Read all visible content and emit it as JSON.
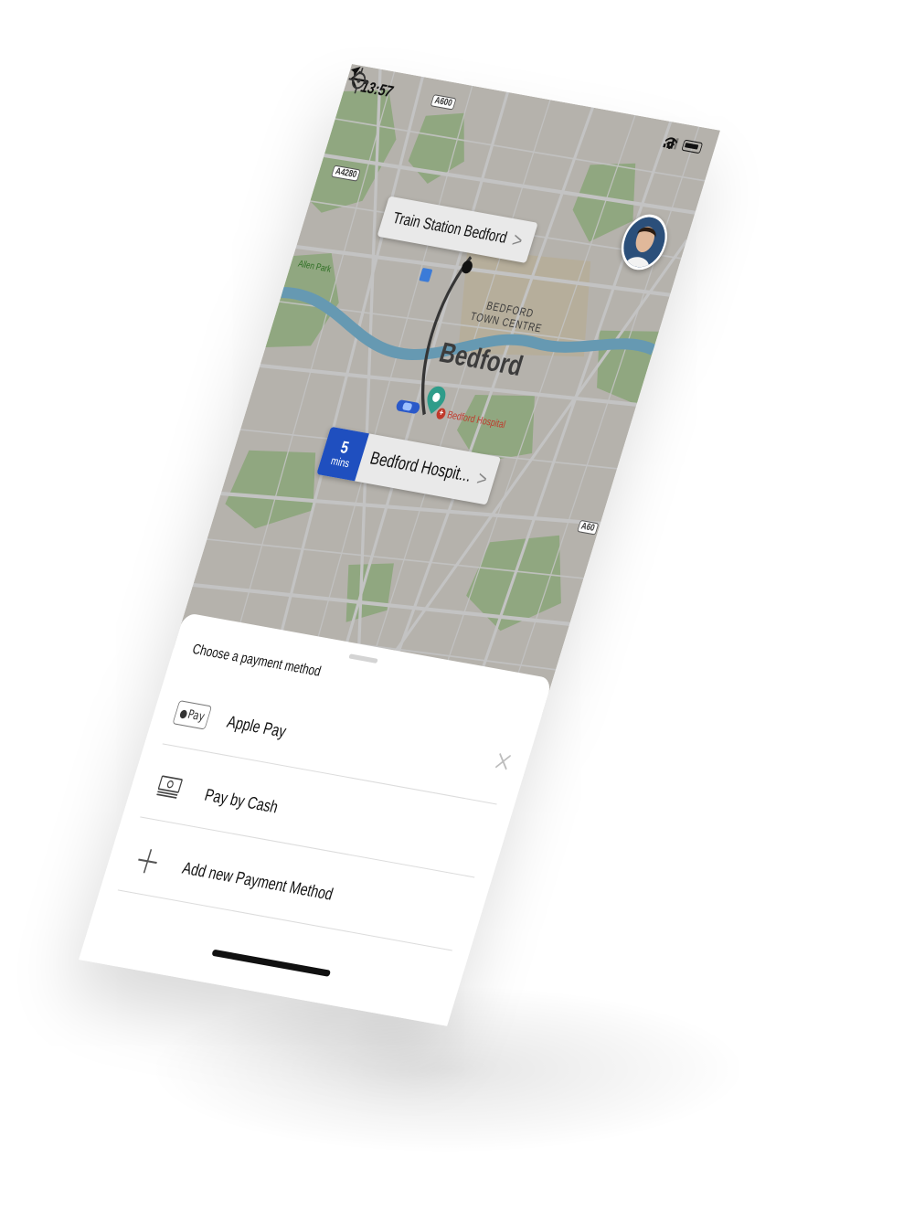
{
  "status_bar": {
    "time": "13:57"
  },
  "map": {
    "road_labels": [
      "A600",
      "A4280",
      "A60"
    ],
    "place_labels": {
      "park": "Allen Park",
      "town_centre_line1": "BEDFORD",
      "town_centre_line2": "TOWN CENTRE",
      "city": "Bedford",
      "hospital": "Bedford Hospital"
    },
    "pickup_callout": {
      "label": "Train Station Bedford",
      "chevron": ">"
    },
    "destination_callout": {
      "eta_value": "5",
      "eta_unit": "mins",
      "label": "Bedford Hospit...",
      "chevron": ">"
    },
    "colors": {
      "land": "#e8e4dc",
      "park": "#b9d9a2",
      "river": "#7ec5e8",
      "route": "#3b3b3b",
      "pickup_pin": "#e07a2c",
      "destination_pin": "#2f9c8a",
      "eta_badge": "#1f4fbf"
    }
  },
  "payment_sheet": {
    "title": "Choose a payment method",
    "close_icon": "close-icon",
    "options": [
      {
        "icon": "apple-pay-icon",
        "icon_text": "Pay",
        "label": "Apple Pay"
      },
      {
        "icon": "cash-icon",
        "label": "Pay by Cash"
      },
      {
        "icon": "plus-icon",
        "label": "Add new Payment Method"
      }
    ]
  }
}
